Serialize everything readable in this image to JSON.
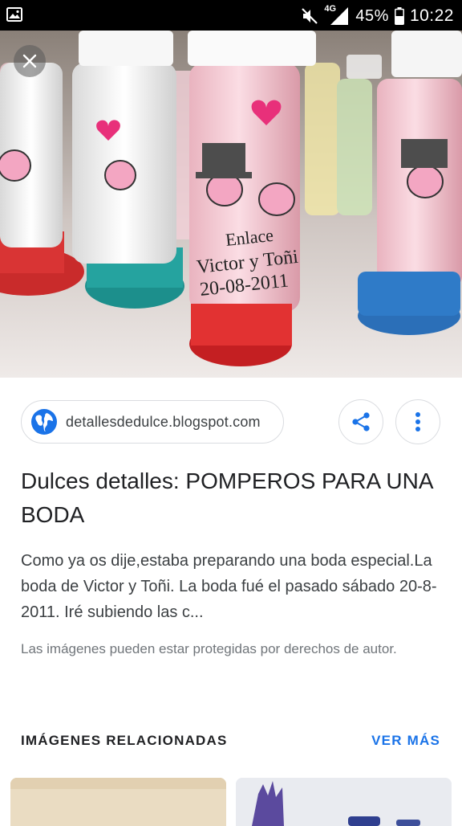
{
  "status_bar": {
    "network": "4G",
    "battery": "45%",
    "time": "10:22"
  },
  "hero": {
    "label_top": "Enlace",
    "label_names": "Victor y Toñi",
    "label_date": "20-08-2011"
  },
  "source": {
    "domain": "detallesdedulce.blogspot.com"
  },
  "result": {
    "title": "Dulces detalles: POMPEROS PARA UNA BODA",
    "snippet": "Como ya os dije,estaba preparando una boda especial.La boda de Victor y Toñi. La boda fué el pasado sábado 20-8-2011. Iré subiendo las c...",
    "copyright": "Las imágenes pueden estar protegidas por derechos de autor."
  },
  "related": {
    "heading": "IMÁGENES RELACIONADAS",
    "see_more": "VER MÁS"
  },
  "colors": {
    "link_blue": "#1a73e8",
    "text_dark": "#202124",
    "text_grey": "#70757a"
  }
}
